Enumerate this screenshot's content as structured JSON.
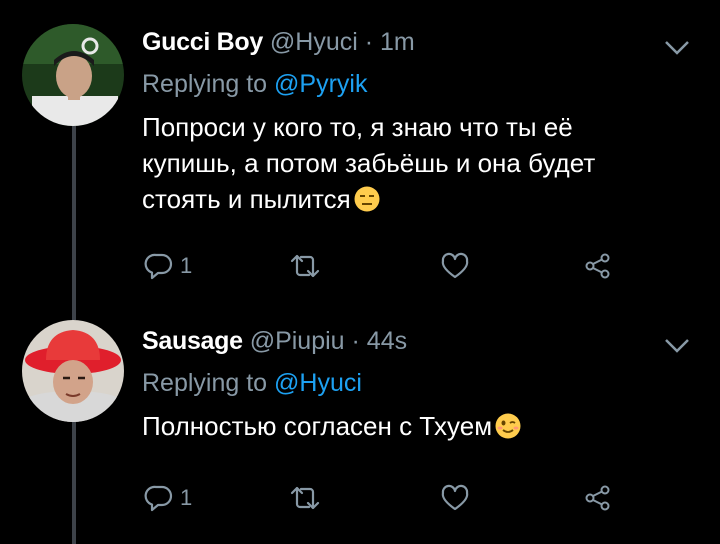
{
  "colors": {
    "background": "#000000",
    "text_primary": "#ffffff",
    "text_secondary": "#8899a6",
    "link": "#1da1f2",
    "thread_line": "#3d4249"
  },
  "tweets": [
    {
      "display_name": "Gucci Boy",
      "handle": "@Hyuci",
      "separator": "·",
      "time": "1m",
      "replying_prefix": "Replying to",
      "replying_to": "@Pyryik",
      "text": "Попроси у кого то, я знаю что ты её купишь, а потом забьёшь и она будет стоять и пылится",
      "emoji": "expressionless-face",
      "reply_count": "1",
      "icons": [
        "reply-icon",
        "retweet-icon",
        "like-icon",
        "share-icon",
        "chevron-down-icon"
      ]
    },
    {
      "display_name": "Sausage",
      "handle": "@Piupiu",
      "separator": "·",
      "time": "44s",
      "replying_prefix": "Replying to",
      "replying_to": "@Hyuci",
      "text": "Полностью согласен с Тхуем",
      "emoji": "winking-face",
      "reply_count": "1",
      "icons": [
        "reply-icon",
        "retweet-icon",
        "like-icon",
        "share-icon",
        "chevron-down-icon"
      ]
    }
  ]
}
